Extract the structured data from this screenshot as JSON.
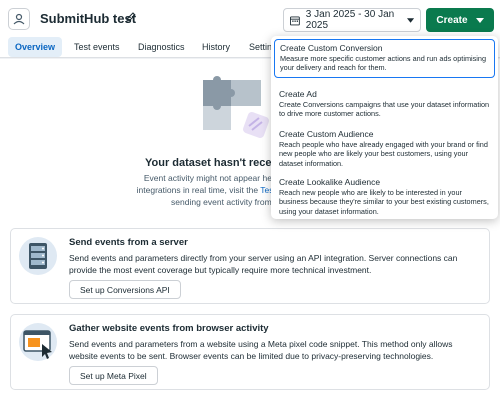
{
  "header": {
    "title": "SubmitHub test",
    "date_range": "3 Jan 2025 - 30 Jan 2025",
    "create_label": "Create"
  },
  "tabs": [
    {
      "label": "Overview",
      "active": true
    },
    {
      "label": "Test events",
      "active": false
    },
    {
      "label": "Diagnostics",
      "active": false
    },
    {
      "label": "History",
      "active": false
    },
    {
      "label": "Settin",
      "active": false
    }
  ],
  "empty_state": {
    "title": "Your dataset hasn't receiv",
    "line1": "Event activity might not appear here for up to 3",
    "line2_a": "integrations in real time, visit the ",
    "line2_link": "Test events tab",
    "line2_b": ". F",
    "line3": "sending event activity from a ser"
  },
  "cards": [
    {
      "title": "Send events from a server",
      "desc": "Send events and parameters directly from your server using an API integration. Server connections can provide the most event coverage but typically require more technical investment.",
      "button": "Set up Conversions API"
    },
    {
      "title": "Gather website events from browser activity",
      "desc": "Send events and parameters from a website using a Meta pixel code snippet. This method only allows website events to be sent. Browser events can be limited due to privacy-preserving technologies.",
      "button": "Set up Meta Pixel"
    }
  ],
  "dropdown": {
    "items": [
      {
        "title": "Create Custom Conversion",
        "desc": "Measure more specific customer actions and run ads optimising your delivery and reach for them."
      },
      {
        "title": "Create Ad",
        "desc": "Create Conversions campaigns that use your dataset information to drive more customer actions."
      },
      {
        "title": "Create Custom Audience",
        "desc": "Reach people who have already engaged with your brand or find new people who are likely your best customers, using your dataset information."
      },
      {
        "title": "Create Lookalike Audience",
        "desc": "Reach new people who are likely to be interested in your business because they're similar to your best existing customers, using your dataset information."
      }
    ]
  },
  "colors": {
    "primary_green": "#0a7a4e",
    "link_blue": "#0a66c2",
    "highlight_border": "#1877f2"
  }
}
